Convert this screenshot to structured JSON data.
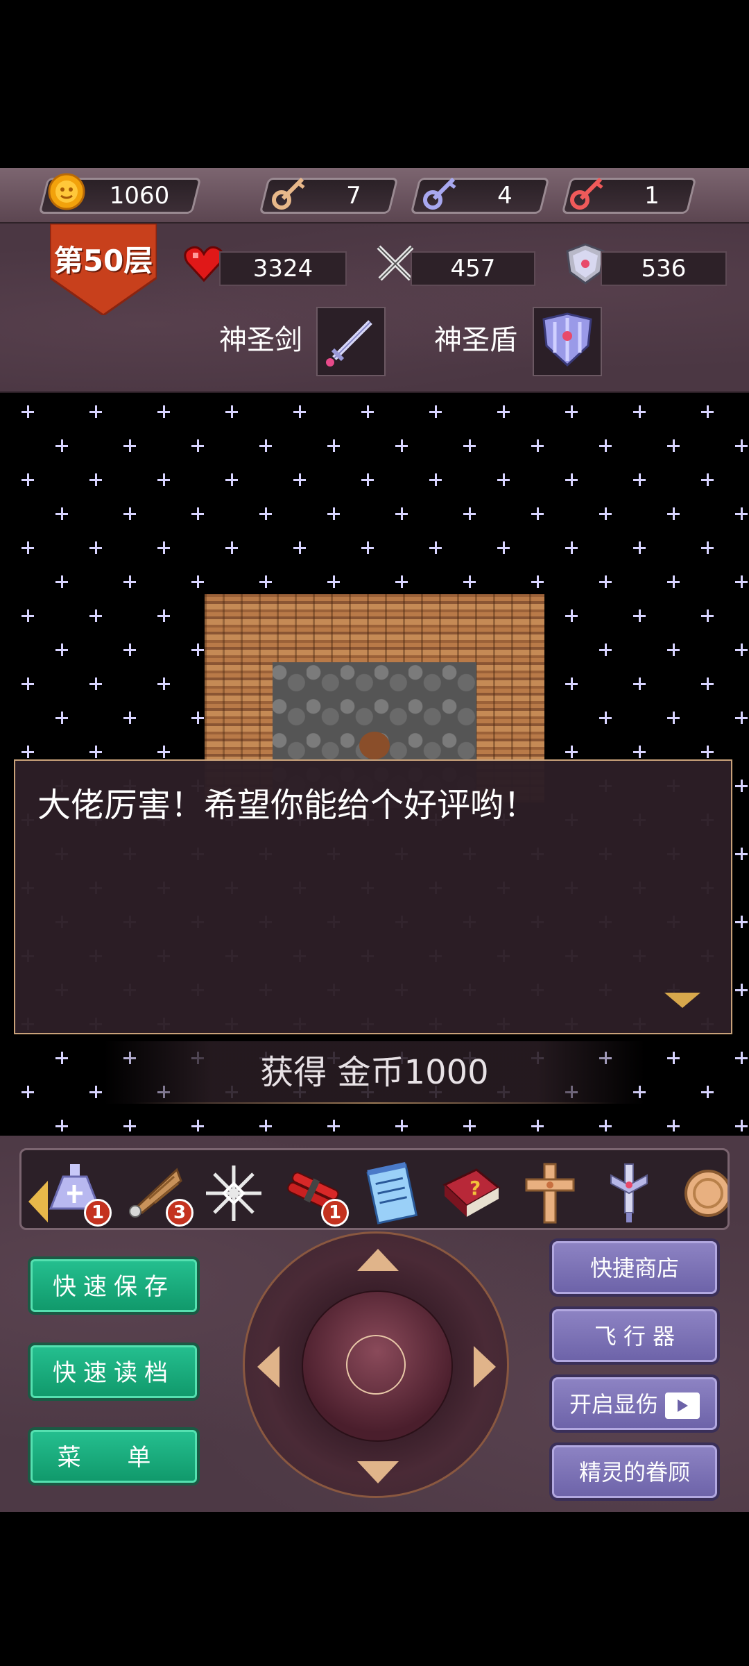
{
  "resources": {
    "gold": "1060",
    "yellow_keys": "7",
    "blue_keys": "4",
    "red_keys": "1"
  },
  "hero": {
    "floor_label": "第50层",
    "hp": "3324",
    "attack": "457",
    "defense": "536",
    "weapon_label": "神圣剑",
    "shield_label": "神圣盾"
  },
  "dialog": {
    "message": "大佬厉害！希望你能给个好评哟！"
  },
  "notice": "获得 金币1000",
  "items": [
    {
      "icon": "holy-water-icon",
      "count": "1"
    },
    {
      "icon": "feather-wing-icon",
      "count": "3"
    },
    {
      "icon": "snowflake-icon",
      "count": ""
    },
    {
      "icon": "dynamite-icon",
      "count": "1"
    },
    {
      "icon": "notepad-icon",
      "count": ""
    },
    {
      "icon": "monster-book-icon",
      "count": ""
    },
    {
      "icon": "cross-icon",
      "count": ""
    },
    {
      "icon": "holy-sword-icon",
      "count": ""
    },
    {
      "icon": "coin-icon",
      "count": ""
    }
  ],
  "buttons": {
    "quick_save": "快速保存",
    "quick_load": "快速读档",
    "menu": "菜 单",
    "quick_shop": "快捷商店",
    "flyer": "飞 行 器",
    "show_damage": "开启显伤",
    "fairy_blessing": "精灵的眷顾"
  },
  "colors": {
    "accent_gold": "#e7b84a",
    "green_button": "#10986a",
    "purple_button": "#6c62a8",
    "floor_banner": "#c8401c"
  }
}
